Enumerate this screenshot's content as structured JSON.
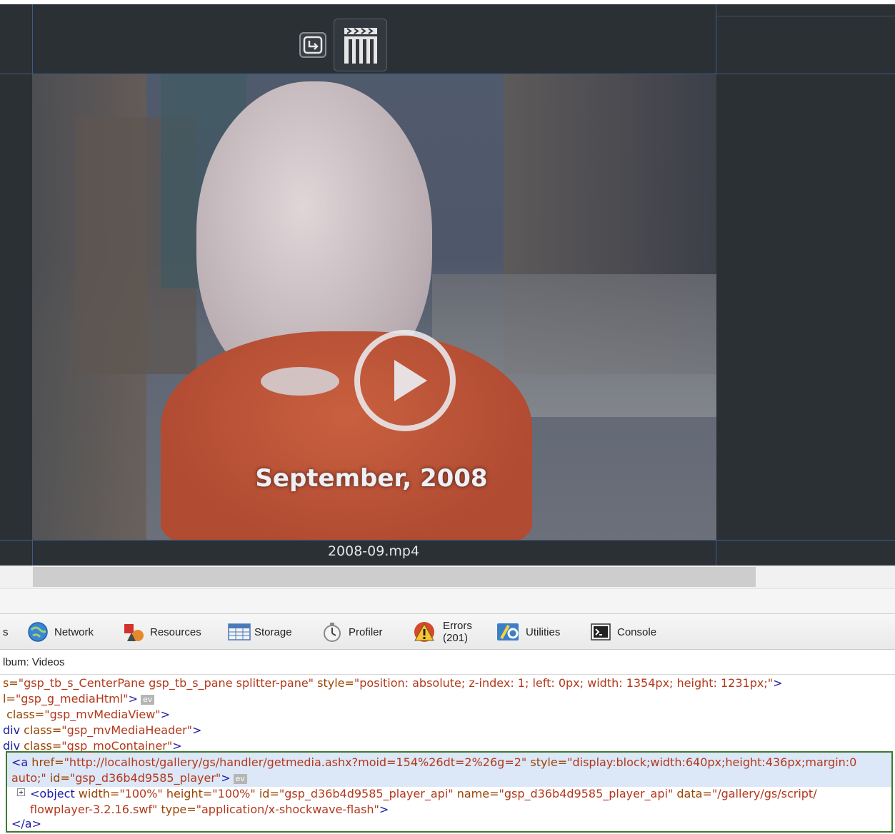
{
  "viewer": {
    "caption": "September, 2008",
    "filename": "2008-09.mp4",
    "toolbar": {
      "download_icon": "download-arrow-icon",
      "slideshow_icon": "film-clapper-icon"
    }
  },
  "devtools": {
    "tabs": [
      {
        "label": "s",
        "icon": "script-icon"
      },
      {
        "label": "Network",
        "icon": "globe-icon"
      },
      {
        "label": "Resources",
        "icon": "shapes-icon"
      },
      {
        "label": "Storage",
        "icon": "table-icon"
      },
      {
        "label": "Profiler",
        "icon": "stopwatch-icon"
      },
      {
        "label": "Errors",
        "count": "(201)",
        "icon": "warning-icon"
      },
      {
        "label": "Utilities",
        "icon": "utilities-icon"
      },
      {
        "label": "Console",
        "icon": "console-icon"
      }
    ],
    "breadcrumb": "lbum: Videos",
    "code_lines": {
      "l1_prefix": "s=",
      "l1_class": "\"gsp_tb_s_CenterPane gsp_tb_s_pane splitter-pane\"",
      "l1_style_attr": " style=",
      "l1_style": "\"position: absolute; z-index: 1; left: 0px; width: 1354px; height: 1231px;\"",
      "l1_close": ">",
      "l2_prefix": "l=",
      "l2_val": "\"gsp_g_mediaHtml\"",
      "l2_close": ">",
      "l3_attr": " class=",
      "l3_val": "\"gsp_mvMediaView\"",
      "l3_close": ">",
      "l4_tag": "div",
      "l4_attr": " class=",
      "l4_val": "\"gsp_mvMediaHeader\"",
      "l4_close": ">",
      "l5_tag": "div",
      "l5_attr": " class=",
      "l5_val": "\"gsp_moContainer\"",
      "l5_close": ">",
      "l6_open": "<a",
      "l6_href_attr": " href=",
      "l6_href": "\"http://localhost/gallery/gs/handler/getmedia.ashx?moid=154%26dt=2%26g=2\"",
      "l6_style_attr": " style=",
      "l6_style": "\"display:block;width:640px;height:436px;margin:0",
      "l7_style_cont": "auto;\"",
      "l7_id_attr": " id=",
      "l7_id": "\"gsp_d36b4d9585_player\"",
      "l7_close": ">",
      "l8_open": "<object",
      "l8_w_attr": " width=",
      "l8_w": "\"100%\"",
      "l8_h_attr": " height=",
      "l8_h": "\"100%\"",
      "l8_id_attr": " id=",
      "l8_id": "\"gsp_d36b4d9585_player_api\"",
      "l8_name_attr": " name=",
      "l8_name": "\"gsp_d36b4d9585_player_api\"",
      "l8_data_attr": " data=",
      "l8_data": "\"/gallery/gs/script/",
      "l9_data_cont": "flowplayer-3.2.16.swf\"",
      "l9_type_attr": " type=",
      "l9_type": "\"application/x-shockwave-flash\"",
      "l9_close": ">",
      "l10": "</a>",
      "badge": "ev"
    }
  }
}
